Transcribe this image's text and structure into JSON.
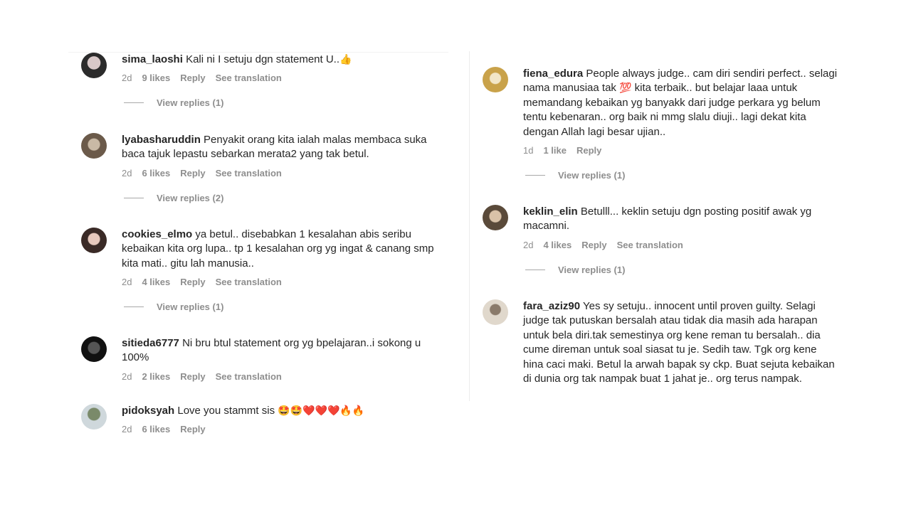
{
  "left": [
    {
      "username": "sima_laoshi",
      "text": "Kali ni I setuju dgn statement U..",
      "emoji": "👍",
      "age": "2d",
      "likes": "9 likes",
      "reply": "Reply",
      "translation": "See translation",
      "view_replies": "View replies (1)",
      "avatar_colors": [
        "#2b2b2b",
        "#d8c8c8"
      ]
    },
    {
      "username": "lyabasharuddin",
      "text": "Penyakit orang kita ialah malas membaca suka baca tajuk lepastu sebarkan merata2 yang tak betul.",
      "emoji": "",
      "age": "2d",
      "likes": "6 likes",
      "reply": "Reply",
      "translation": "See translation",
      "view_replies": "View replies (2)",
      "avatar_colors": [
        "#6b5a4a",
        "#c9b9a5"
      ]
    },
    {
      "username": "cookies_elmo",
      "text": "ya betul.. disebabkan 1 kesalahan abis seribu kebaikan kita org lupa.. tp 1 kesalahan org yg ingat & canang smp kita mati.. gitu lah manusia..",
      "emoji": "",
      "age": "2d",
      "likes": "4 likes",
      "reply": "Reply",
      "translation": "See translation",
      "view_replies": "View replies (1)",
      "avatar_colors": [
        "#3a2a26",
        "#e7c9bd"
      ]
    },
    {
      "username": "sitieda6777",
      "text": "Ni bru btul statement org yg bpelajaran..i sokong u 100%",
      "emoji": "",
      "age": "2d",
      "likes": "2 likes",
      "reply": "Reply",
      "translation": "See translation",
      "view_replies": "",
      "avatar_colors": [
        "#111111",
        "#555555"
      ]
    },
    {
      "username": "pidoksyah",
      "text": "Love you stammt sis",
      "emoji": "🤩🤩❤️❤️❤️🔥🔥",
      "age": "2d",
      "likes": "6 likes",
      "reply": "Reply",
      "translation": "",
      "view_replies": "",
      "avatar_colors": [
        "#cfd8dc",
        "#7a8a6a"
      ]
    }
  ],
  "right": [
    {
      "username": "fiena_edura",
      "text": "People always judge.. cam diri sendiri perfect.. selagi nama manusiaa tak",
      "emoji": "💯",
      "text2": " kita terbaik.. but belajar laaa untuk memandang kebaikan yg banyakk dari judge perkara yg belum tentu kebenaran.. org baik ni mmg slalu diuji.. lagi dekat kita dengan Allah lagi besar ujian..",
      "age": "1d",
      "likes": "1 like",
      "reply": "Reply",
      "translation": "",
      "view_replies": "View replies (1)",
      "avatar_colors": [
        "#c9a24a",
        "#f2e6c8"
      ]
    },
    {
      "username": "keklin_elin",
      "text": "Betulll... keklin setuju dgn posting positif awak yg macamni.",
      "emoji": "",
      "text2": "",
      "age": "2d",
      "likes": "4 likes",
      "reply": "Reply",
      "translation": "See translation",
      "view_replies": "View replies (1)",
      "avatar_colors": [
        "#5a4a3a",
        "#d9c2a8"
      ]
    },
    {
      "username": "fara_aziz90",
      "text": "Yes sy setuju.. innocent until proven guilty. Selagi judge tak putuskan bersalah atau tidak dia masih ada harapan untuk bela diri.tak semestinya org kene reman tu bersalah.. dia cume direman untuk soal siasat tu je. Sedih taw. Tgk org kene hina caci maki. Betul la arwah bapak sy ckp. Buat sejuta kebaikan di dunia org tak nampak buat 1 jahat je.. org terus nampak.",
      "emoji": "",
      "text2": "",
      "age": "",
      "likes": "",
      "reply": "",
      "translation": "",
      "view_replies": "",
      "avatar_colors": [
        "#e0d8cc",
        "#8a7a6a"
      ]
    }
  ]
}
